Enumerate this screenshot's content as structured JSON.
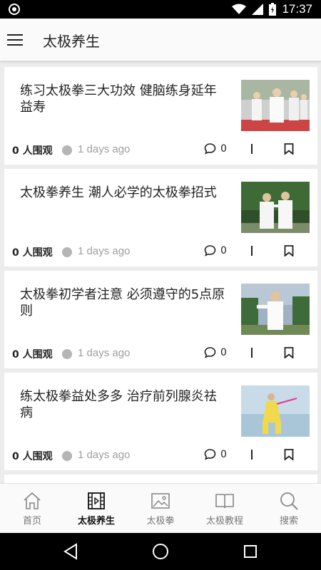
{
  "status_bar": {
    "time": "17:37"
  },
  "app_bar": {
    "title": "太极养生"
  },
  "feed": {
    "items": [
      {
        "title": "练习太极拳三大功效 健脑练身延年益寿",
        "views": "0 人围观",
        "time": "1 days ago",
        "comments": "0"
      },
      {
        "title": "太极拳养生 潮人必学的太极拳招式",
        "views": "0 人围观",
        "time": "1 days ago",
        "comments": "0"
      },
      {
        "title": "太极拳初学者注意 必须遵守的5点原则",
        "views": "0 人围观",
        "time": "1 days ago",
        "comments": "0"
      },
      {
        "title": "练太极拳益处多多 治疗前列腺炎祛病",
        "views": "0 人围观",
        "time": "1 days ago",
        "comments": "0"
      }
    ]
  },
  "bottom_nav": {
    "items": [
      {
        "label": "首页",
        "icon": "home-icon",
        "active": false
      },
      {
        "label": "太极养生",
        "icon": "film-icon",
        "active": true
      },
      {
        "label": "太极拳",
        "icon": "image-icon",
        "active": false
      },
      {
        "label": "太极教程",
        "icon": "book-icon",
        "active": false
      },
      {
        "label": "搜索",
        "icon": "search-icon",
        "active": false
      }
    ]
  },
  "colors": {
    "background": "#ececec",
    "card": "#ffffff",
    "muted_text": "#9e9e9e",
    "dot": "#b5b5b5",
    "active_nav": "#111111"
  }
}
